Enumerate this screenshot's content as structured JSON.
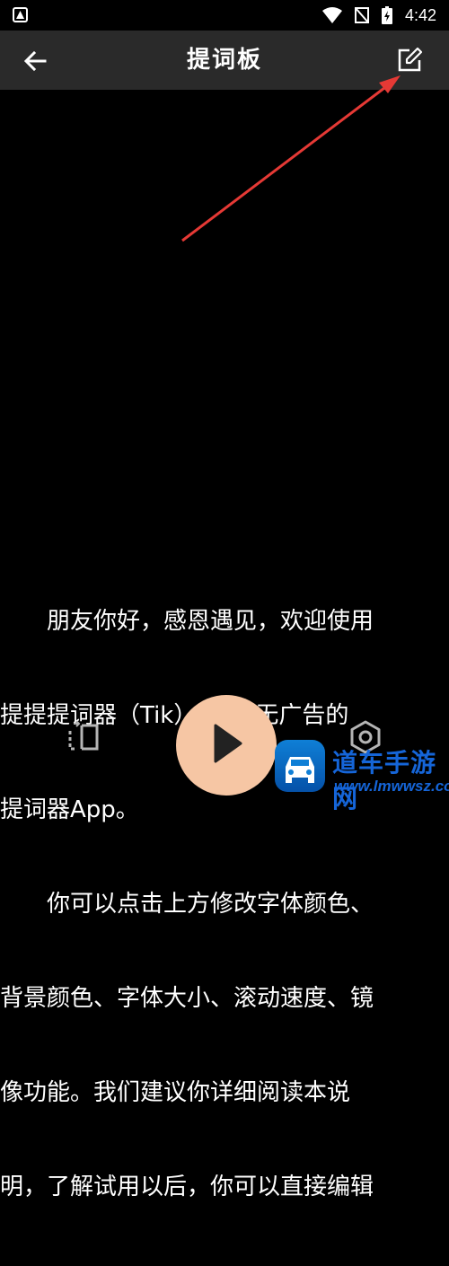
{
  "status_bar": {
    "time": "4:42"
  },
  "toolbar": {
    "title": "提词板"
  },
  "script_lines": [
    "　　朋友你好，感恩遇见，欢迎使用",
    "提提提词器（Tik），免费无广告的",
    "提词器App。",
    "　　你可以点击上方修改字体颜色、",
    "背景颜色、字体大小、滚动速度、镜",
    "像功能。我们建议你详细阅读本说",
    "明，了解试用以后，你可以直接编辑"
  ],
  "watermark": {
    "brand": "道车手游网",
    "url": "www.lmwwsz.com"
  },
  "colors": {
    "play_button": "#f6c6a4",
    "arrow": "#e53935",
    "toolbar": "#2a2a2a"
  }
}
